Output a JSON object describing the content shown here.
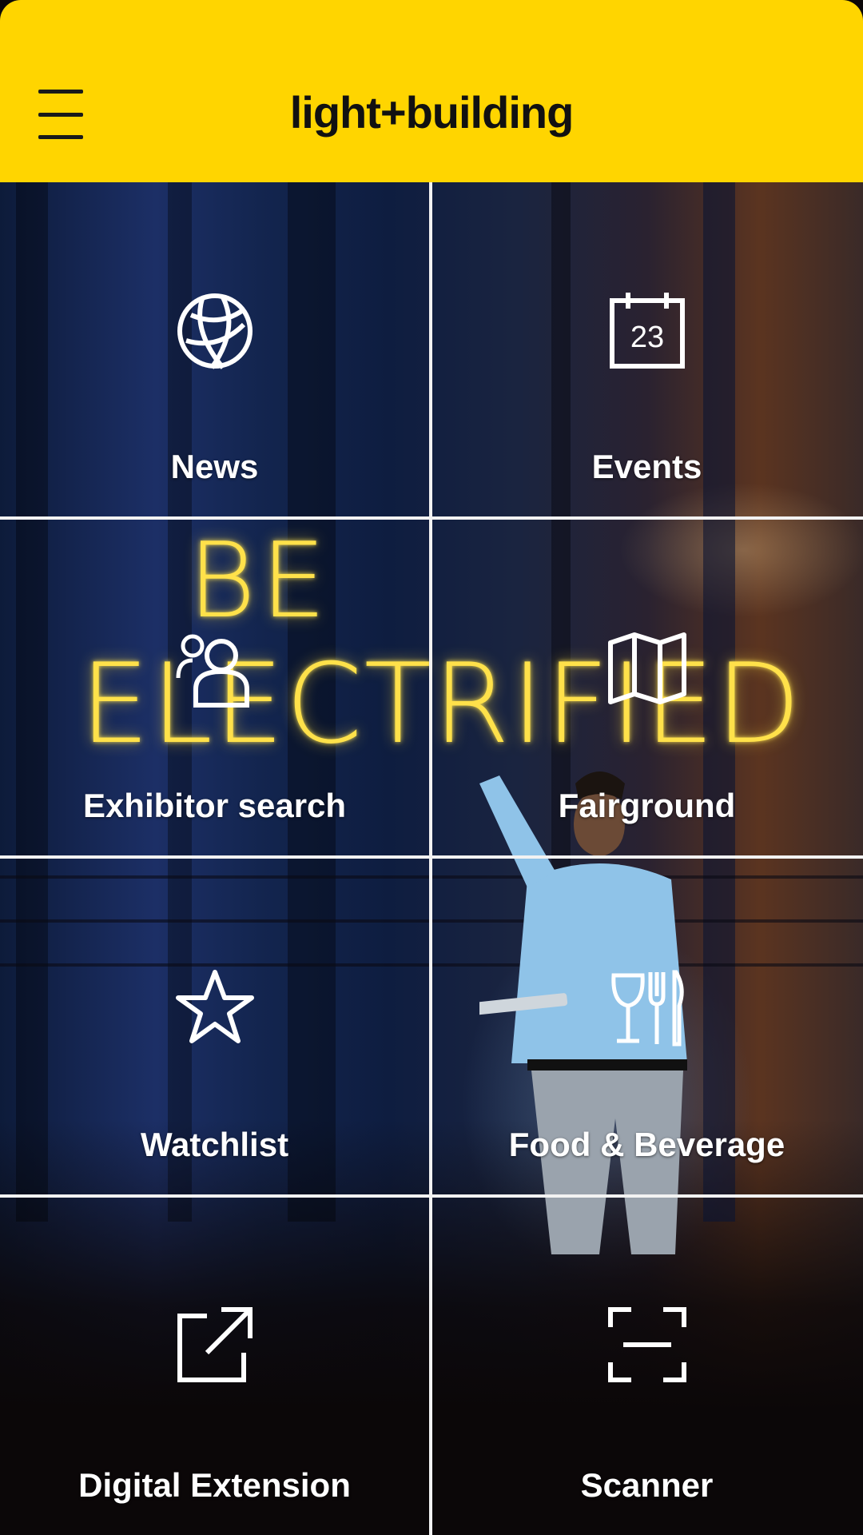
{
  "header": {
    "title": "light+building",
    "menu_icon": "hamburger-menu-icon",
    "color": "#ffd500"
  },
  "background": {
    "headline_line1": "BE",
    "headline_line2": "ELECTRIFIED",
    "glow_color": "#ffe14a"
  },
  "tiles": [
    {
      "label": "News",
      "icon": "globe-icon"
    },
    {
      "label": "Events",
      "icon": "calendar-icon",
      "icon_text": "23"
    },
    {
      "label": "Exhibitor search",
      "icon": "exhibitor-person-icon"
    },
    {
      "label": "Fairground",
      "icon": "map-icon"
    },
    {
      "label": "Watchlist",
      "icon": "star-icon"
    },
    {
      "label": "Food & Beverage",
      "icon": "food-beverage-icon"
    },
    {
      "label": "Digital Extension",
      "icon": "external-link-icon"
    },
    {
      "label": "Scanner",
      "icon": "scanner-icon"
    }
  ]
}
